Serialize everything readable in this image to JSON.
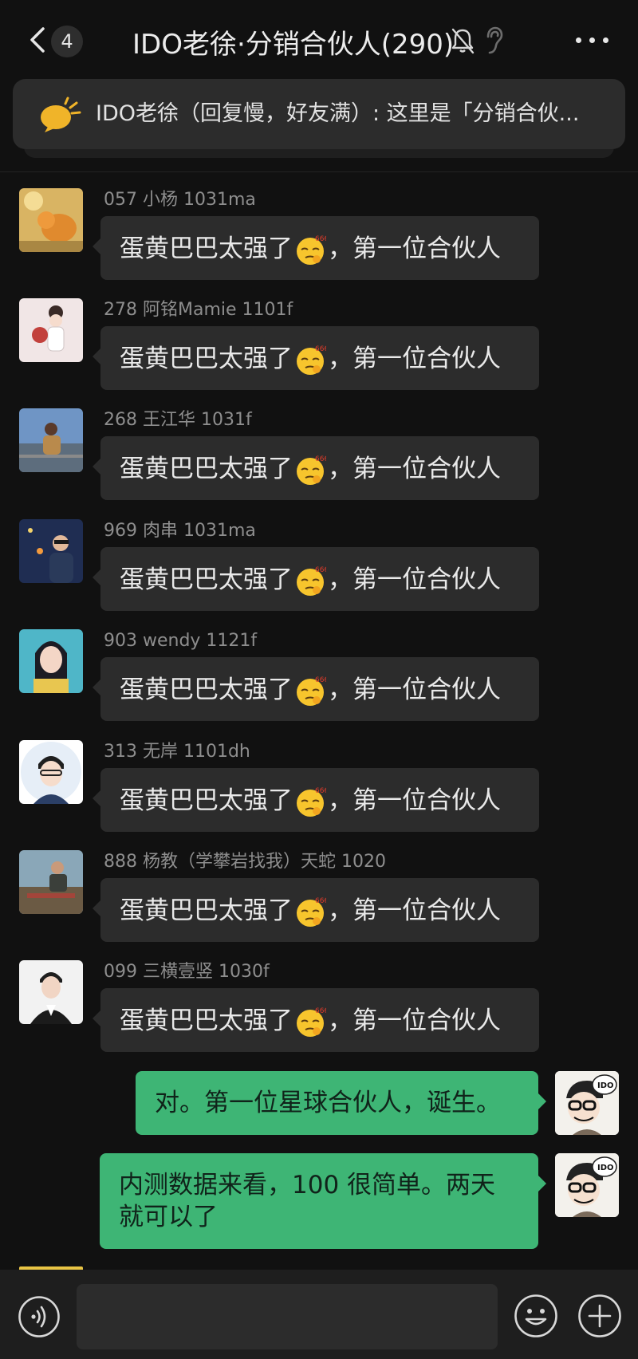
{
  "header": {
    "unread_count": "4",
    "title": "IDO老徐·分销合伙人(290)"
  },
  "notice": {
    "text": "IDO老徐（回复慢，好友满）: 这里是「分销合伙..."
  },
  "messages": [
    {
      "sender": "057 小杨 1031ma",
      "text_before": "蛋黄巴巴太强了",
      "emoji": "666-smirk-emoji",
      "text_after": "，第一位合伙人"
    },
    {
      "sender": "278 阿铭Mamie 1101f",
      "text_before": "蛋黄巴巴太强了",
      "emoji": "666-smirk-emoji",
      "text_after": "，第一位合伙人"
    },
    {
      "sender": "268 王江华 1031f",
      "text_before": "蛋黄巴巴太强了",
      "emoji": "666-smirk-emoji",
      "text_after": "，第一位合伙人"
    },
    {
      "sender": "969 肉串 1031ma",
      "text_before": "蛋黄巴巴太强了",
      "emoji": "666-smirk-emoji",
      "text_after": "，第一位合伙人"
    },
    {
      "sender": "903 wendy 1121f",
      "text_before": "蛋黄巴巴太强了",
      "emoji": "666-smirk-emoji",
      "text_after": "，第一位合伙人"
    },
    {
      "sender": "313 无岸 1101dh",
      "text_before": "蛋黄巴巴太强了",
      "emoji": "666-smirk-emoji",
      "text_after": "，第一位合伙人"
    },
    {
      "sender": "888 杨教（学攀岩找我）天蛇 1020",
      "text_before": "蛋黄巴巴太强了",
      "emoji": "666-smirk-emoji",
      "text_after": "，第一位合伙人"
    },
    {
      "sender": "099 三横壹竖 1030f",
      "text_before": "蛋黄巴巴太强了",
      "emoji": "666-smirk-emoji",
      "text_after": "，第一位合伙人"
    }
  ],
  "my_messages": [
    {
      "text": "对。第一位星球合伙人，诞生。"
    },
    {
      "line1": "内测数据来看，100 很简单。两天",
      "line2": "就可以了"
    }
  ],
  "my_avatar_label": "IDO",
  "colors": {
    "background": "#111111",
    "bubble_other": "#2c2c2c",
    "bubble_mine": "#3eb575",
    "accent_notice": "#f0b429"
  }
}
